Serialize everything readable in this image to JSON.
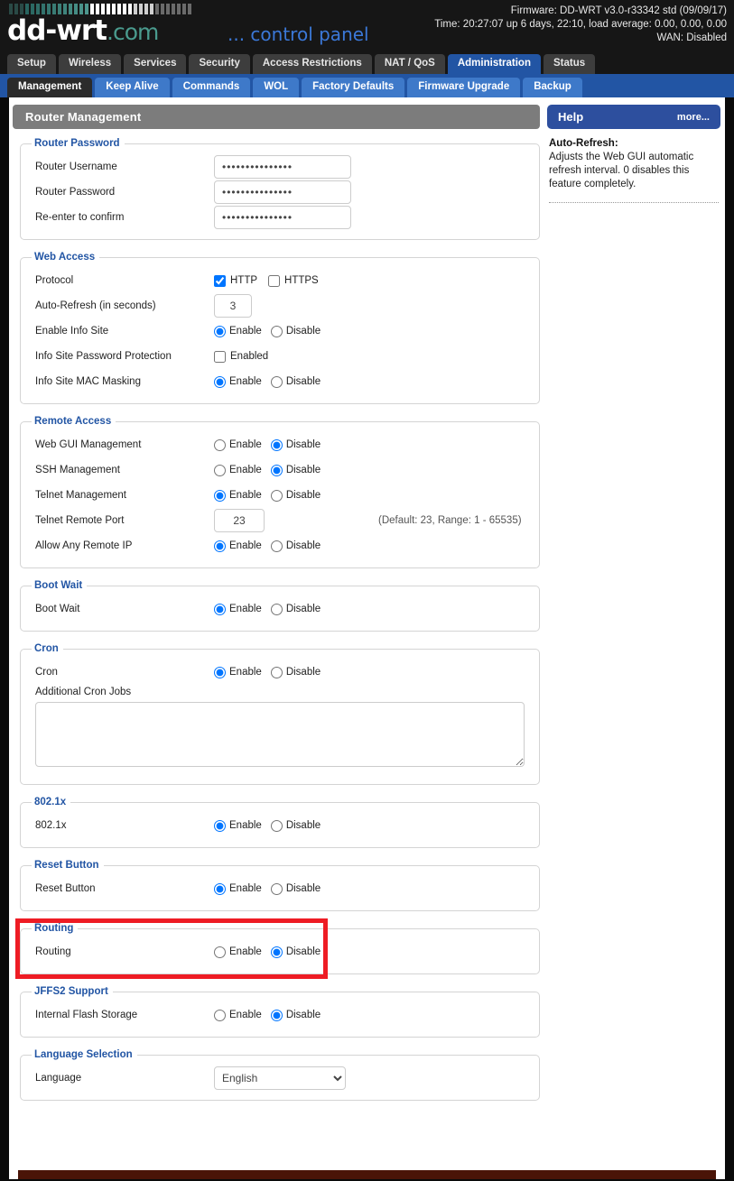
{
  "header": {
    "logo_text": "dd-wrt",
    "logo_suffix": ".com",
    "control_panel": "... control panel",
    "firmware": "Firmware: DD-WRT v3.0-r33342 std (09/09/17)",
    "time": "Time: 20:27:07 up 6 days, 22:10, load average: 0.00, 0.00, 0.00",
    "wan": "WAN: Disabled"
  },
  "primary_tabs": [
    {
      "label": "Setup",
      "active": false
    },
    {
      "label": "Wireless",
      "active": false
    },
    {
      "label": "Services",
      "active": false
    },
    {
      "label": "Security",
      "active": false
    },
    {
      "label": "Access Restrictions",
      "active": false
    },
    {
      "label": "NAT / QoS",
      "active": false
    },
    {
      "label": "Administration",
      "active": true
    },
    {
      "label": "Status",
      "active": false
    }
  ],
  "secondary_tabs": [
    {
      "label": "Management",
      "active": true
    },
    {
      "label": "Keep Alive",
      "active": false
    },
    {
      "label": "Commands",
      "active": false
    },
    {
      "label": "WOL",
      "active": false
    },
    {
      "label": "Factory Defaults",
      "active": false
    },
    {
      "label": "Firmware Upgrade",
      "active": false
    },
    {
      "label": "Backup",
      "active": false
    }
  ],
  "page_title": "Router Management",
  "sections": {
    "router_password": {
      "legend": "Router Password",
      "username_label": "Router Username",
      "username_value": "•••••••••••••••",
      "password_label": "Router Password",
      "password_value": "•••••••••••••••",
      "confirm_label": "Re-enter to confirm",
      "confirm_value": "•••••••••••••••"
    },
    "web_access": {
      "legend": "Web Access",
      "protocol_label": "Protocol",
      "http_label": "HTTP",
      "http_checked": true,
      "https_label": "HTTPS",
      "https_checked": false,
      "autorefresh_label": "Auto-Refresh (in seconds)",
      "autorefresh_value": "3",
      "info_site_label": "Enable Info Site",
      "info_site_value": "Enable",
      "info_pw_label": "Info Site Password Protection",
      "info_pw_checkbox_label": "Enabled",
      "info_pw_checked": false,
      "mac_mask_label": "Info Site MAC Masking",
      "mac_mask_value": "Enable"
    },
    "remote_access": {
      "legend": "Remote Access",
      "webgui_label": "Web GUI Management",
      "webgui_value": "Disable",
      "ssh_label": "SSH Management",
      "ssh_value": "Disable",
      "telnet_label": "Telnet Management",
      "telnet_value": "Enable",
      "telnet_port_label": "Telnet Remote Port",
      "telnet_port_value": "23",
      "telnet_port_hint": "(Default: 23, Range: 1 - 65535)",
      "allow_ip_label": "Allow Any Remote IP",
      "allow_ip_value": "Enable"
    },
    "boot_wait": {
      "legend": "Boot Wait",
      "label": "Boot Wait",
      "value": "Enable"
    },
    "cron": {
      "legend": "Cron",
      "label": "Cron",
      "value": "Enable",
      "jobs_label": "Additional Cron Jobs",
      "jobs_value": ""
    },
    "dot1x": {
      "legend": "802.1x",
      "label": "802.1x",
      "value": "Enable"
    },
    "reset_button": {
      "legend": "Reset Button",
      "label": "Reset Button",
      "value": "Enable"
    },
    "routing": {
      "legend": "Routing",
      "label": "Routing",
      "value": "Disable",
      "highlighted": true
    },
    "jffs2": {
      "legend": "JFFS2 Support",
      "label": "Internal Flash Storage",
      "value": "Disable"
    },
    "language": {
      "legend": "Language Selection",
      "label": "Language",
      "value": "English",
      "options": [
        "English"
      ]
    }
  },
  "radio_labels": {
    "enable": "Enable",
    "disable": "Disable"
  },
  "help": {
    "title": "Help",
    "more": "more...",
    "heading": "Auto-Refresh:",
    "body": "Adjusts the Web GUI automatic refresh interval. 0 disables this feature completely."
  },
  "colors": {
    "accent_blue": "#2255a4",
    "tab_blue": "#3e79c9",
    "title_gray": "#7c7c7c",
    "legend_blue": "#2255a4",
    "highlight_red": "#ee1c24",
    "logo_teal": "#4a9b8e"
  }
}
